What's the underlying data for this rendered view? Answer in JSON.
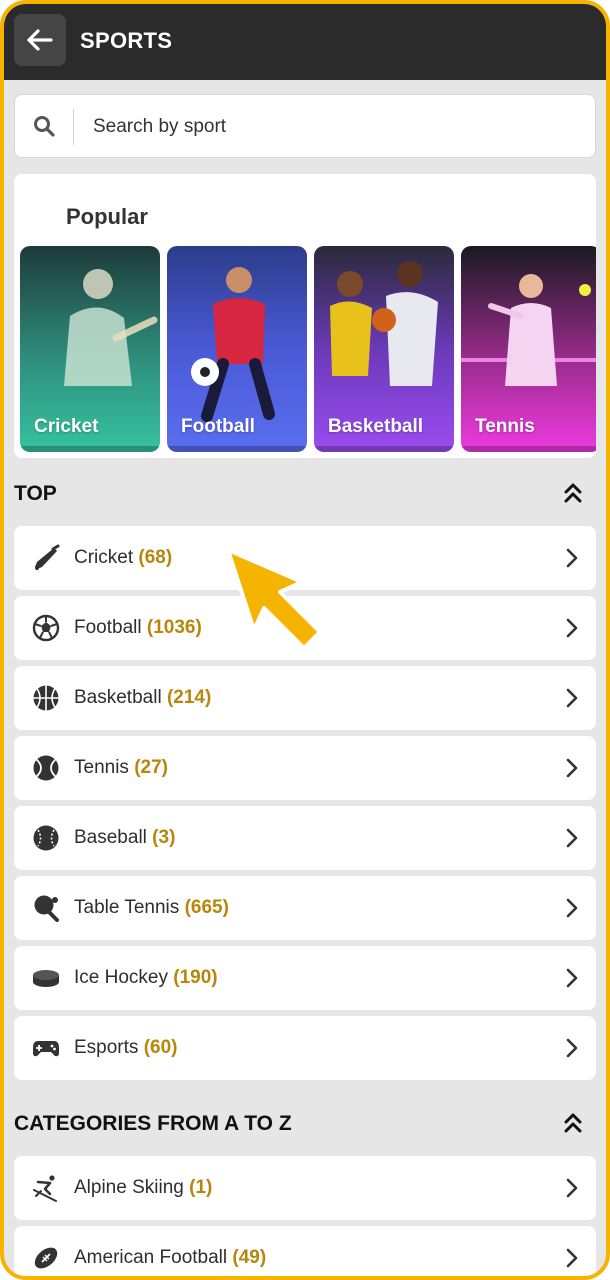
{
  "header": {
    "title": "SPORTS",
    "back_icon": "arrow-left-icon"
  },
  "search": {
    "placeholder": "Search by sport",
    "icon": "search-icon"
  },
  "popular": {
    "title": "Popular",
    "tiles": [
      {
        "label": "Cricket",
        "color": "#2fb69a"
      },
      {
        "label": "Football",
        "color": "#3f56d8"
      },
      {
        "label": "Basketball",
        "color": "#8a3fe0"
      },
      {
        "label": "Tennis",
        "color": "#e03ad6"
      }
    ]
  },
  "top": {
    "title": "TOP",
    "items": [
      {
        "label": "Cricket",
        "count": "(68)",
        "icon": "cricket-bat-icon"
      },
      {
        "label": "Football",
        "count": "(1036)",
        "icon": "soccer-ball-icon"
      },
      {
        "label": "Basketball",
        "count": "(214)",
        "icon": "basketball-icon"
      },
      {
        "label": "Tennis",
        "count": "(27)",
        "icon": "tennis-ball-icon"
      },
      {
        "label": "Baseball",
        "count": "(3)",
        "icon": "baseball-icon"
      },
      {
        "label": "Table Tennis",
        "count": "(665)",
        "icon": "table-tennis-paddle-icon"
      },
      {
        "label": "Ice Hockey",
        "count": "(190)",
        "icon": "hockey-puck-icon"
      },
      {
        "label": "Esports",
        "count": "(60)",
        "icon": "gamepad-icon"
      }
    ]
  },
  "az": {
    "title": "CATEGORIES FROM A TO Z",
    "items": [
      {
        "label": "Alpine Skiing",
        "count": "(1)",
        "icon": "skier-icon"
      },
      {
        "label": "American Football",
        "count": "(49)",
        "icon": "american-football-icon"
      }
    ]
  },
  "colors": {
    "accent": "#f5b400",
    "count": "#b8860b",
    "header": "#2b2b2b"
  }
}
